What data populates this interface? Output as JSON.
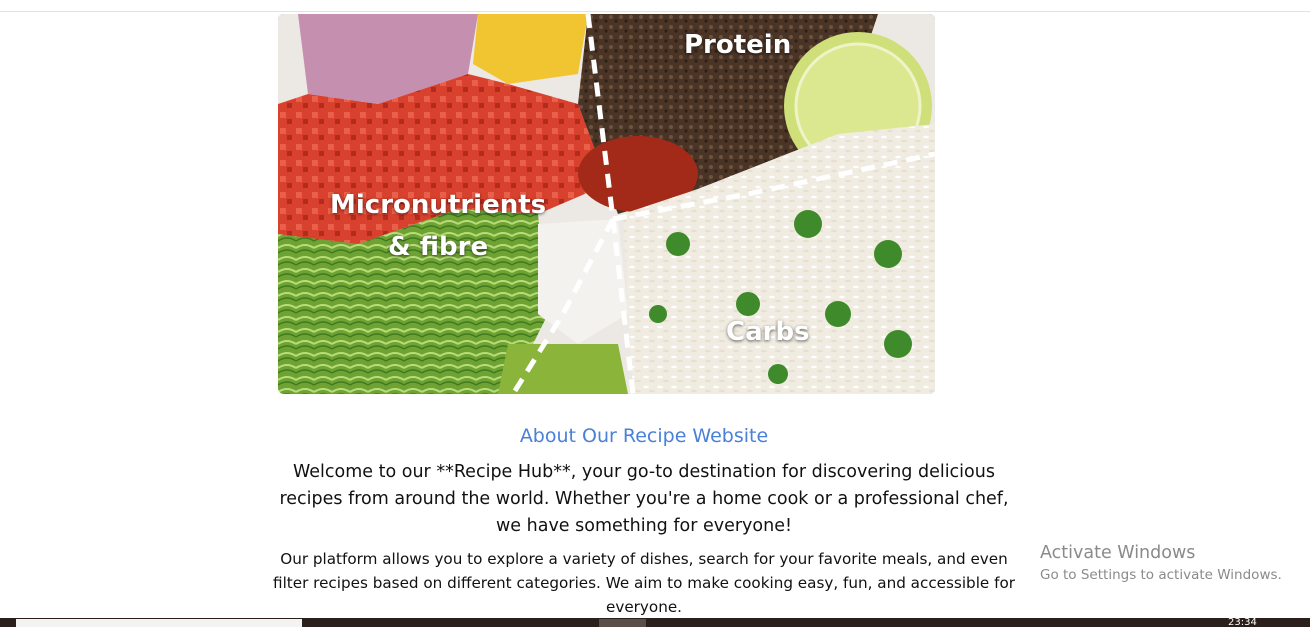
{
  "hero": {
    "labels": {
      "protein": "Protein",
      "micronutrients_line1": "Micronutrients",
      "micronutrients_line2": "& fibre",
      "carbs": "Carbs"
    }
  },
  "about": {
    "title": "About Our Recipe Website",
    "paragraph1": "Welcome to our **Recipe Hub**, your go-to destination for discovering delicious recipes from around the world. Whether you're a home cook or a professional chef, we have something for everyone!",
    "paragraph2": "Our platform allows you to explore a variety of dishes, search for your favorite meals, and even filter recipes based on different categories. We aim to make cooking easy, fun, and accessible for everyone."
  },
  "watermark": {
    "line1": "Activate Windows",
    "line2": "Go to Settings to activate Windows."
  },
  "taskbar": {
    "clock": "23:34"
  },
  "colors": {
    "title_blue": "#4a80d8",
    "watermark_gray": "#8a8a8a",
    "taskbar_dark": "#2a1f1a"
  }
}
